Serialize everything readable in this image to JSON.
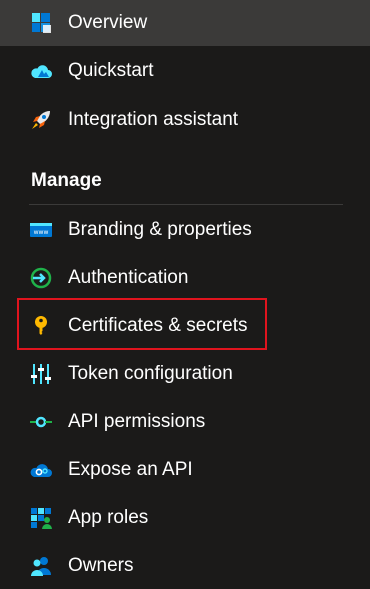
{
  "nav": {
    "top_items": [
      {
        "label": "Overview",
        "icon": "overview-icon",
        "selected": true
      },
      {
        "label": "Quickstart",
        "icon": "cloud-icon"
      },
      {
        "label": "Integration assistant",
        "icon": "rocket-icon"
      }
    ],
    "section_title": "Manage",
    "manage_items": [
      {
        "label": "Branding & properties",
        "icon": "branding-icon"
      },
      {
        "label": "Authentication",
        "icon": "authentication-icon"
      },
      {
        "label": "Certificates & secrets",
        "icon": "key-icon",
        "highlighted": true
      },
      {
        "label": "Token configuration",
        "icon": "sliders-icon"
      },
      {
        "label": "API permissions",
        "icon": "api-permissions-icon"
      },
      {
        "label": "Expose an API",
        "icon": "cloud-gear-icon"
      },
      {
        "label": "App roles",
        "icon": "app-roles-icon"
      },
      {
        "label": "Owners",
        "icon": "owners-icon"
      }
    ]
  },
  "colors": {
    "background": "#1b1a19",
    "selected_background": "#3b3a39",
    "highlight_border": "#e0141e",
    "icon_blue": "#0078d4",
    "icon_light_blue": "#50e6ff",
    "icon_gold": "#ffb900"
  }
}
